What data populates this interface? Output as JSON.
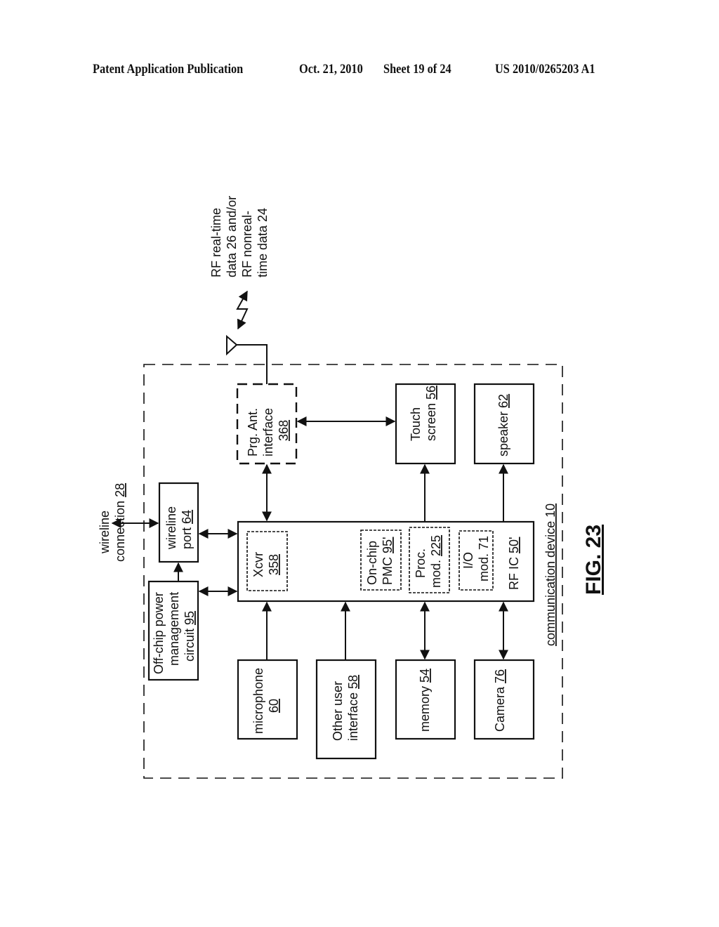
{
  "header": {
    "publication": "Patent Application Publication",
    "date": "Oct. 21, 2010",
    "sheet": "Sheet 19 of 24",
    "number": "US 2010/0265203 A1"
  },
  "diagram": {
    "rf_data_label": [
      "RF real-time",
      "data 26 and/or",
      "RF nonreal-",
      "time data  24"
    ],
    "wireline_connection": {
      "line1": "wireline",
      "line2": "connection ",
      "ref": "28"
    },
    "wireline_port": {
      "line1": "wireline",
      "line2": "port ",
      "ref": "64"
    },
    "off_chip_pmc": {
      "line1": "Off-chip power",
      "line2": "management",
      "line3": "circuit ",
      "ref": "95"
    },
    "prg_ant": {
      "line1": "Prg. Ant.",
      "line2": "interface",
      "ref": "368"
    },
    "touch_screen": {
      "line1": "Touch",
      "line2": "screen ",
      "ref": "56"
    },
    "speaker": {
      "line1": "speaker ",
      "ref": "62"
    },
    "rf_ic": {
      "label": "RF IC ",
      "ref": "50'"
    },
    "xcvr": {
      "line1": "Xcvr",
      "ref": "358"
    },
    "on_chip_pmc": {
      "line1": "On-chip",
      "line2": "PMC ",
      "ref": "95'"
    },
    "proc_mod": {
      "line1": "Proc.",
      "line2": "mod. ",
      "ref": "225"
    },
    "io_mod": {
      "line1": "I/O",
      "line2": "mod. 71"
    },
    "microphone": {
      "line1": "microphone",
      "ref": "60"
    },
    "other_ui": {
      "line1": "Other user",
      "line2": "interface ",
      "ref": "58"
    },
    "memory": {
      "line1": "memory ",
      "ref": "54"
    },
    "camera": {
      "line1": "Camera ",
      "ref": "76"
    },
    "device": {
      "label": "communication device 10"
    },
    "figure": {
      "label": "FIG. 23"
    }
  }
}
